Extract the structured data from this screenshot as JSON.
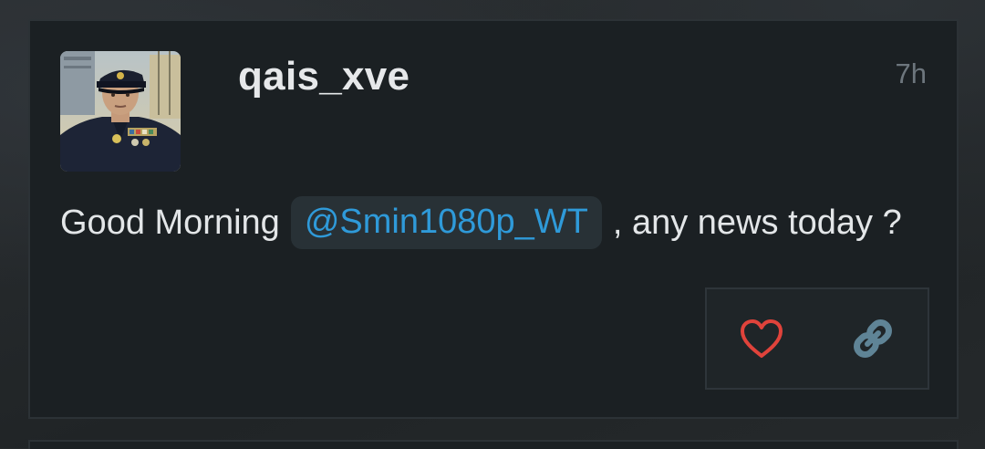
{
  "post": {
    "username": "qais_xve",
    "time_ago": "7h",
    "message": {
      "before": "Good Morning",
      "mention": "@Smin1080p_WT",
      "after": ", any news today ?"
    },
    "avatar_icon": "officer-portrait",
    "actions": [
      {
        "icon": "heart-icon",
        "color": "#e0433b"
      },
      {
        "icon": "link-icon",
        "color": "#5f8496"
      }
    ]
  },
  "colors": {
    "card_bg": "#1b2023",
    "mention_text": "#2f9ad9",
    "mention_bg": "#283136"
  }
}
